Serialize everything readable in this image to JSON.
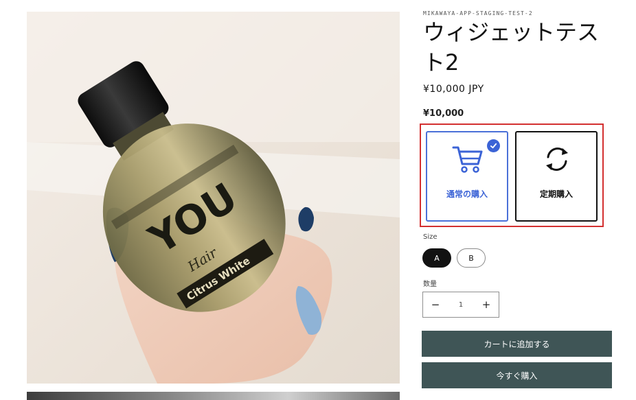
{
  "product": {
    "vendor": "MIKAWAYA-APP-STAGING-TEST-2",
    "title": "ウィジェットテスト2",
    "price": "¥10,000 JPY",
    "widget_price": "¥10,000",
    "image_alt": "Hand holding a bottle labelled YOU Hair Citrus White",
    "image_text": {
      "brand": "YOU",
      "line": "Hair",
      "variant": "Citrus White"
    }
  },
  "purchase_widget": {
    "options": [
      {
        "label": "通常の購入",
        "icon": "cart-icon",
        "selected": true
      },
      {
        "label": "定期購入",
        "icon": "refresh-cycle-icon",
        "selected": false
      }
    ],
    "accent_color": "#3b63d6",
    "highlight_color": "#d32f2f"
  },
  "size": {
    "label": "Size",
    "options": [
      {
        "label": "A",
        "selected": true
      },
      {
        "label": "B",
        "selected": false
      }
    ]
  },
  "quantity": {
    "label": "数量",
    "value": "1",
    "minus": "−",
    "plus": "+"
  },
  "actions": {
    "add_to_cart": "カートに追加する",
    "buy_now": "今すぐ購入"
  },
  "theme": {
    "button_color": "#3f5556"
  }
}
